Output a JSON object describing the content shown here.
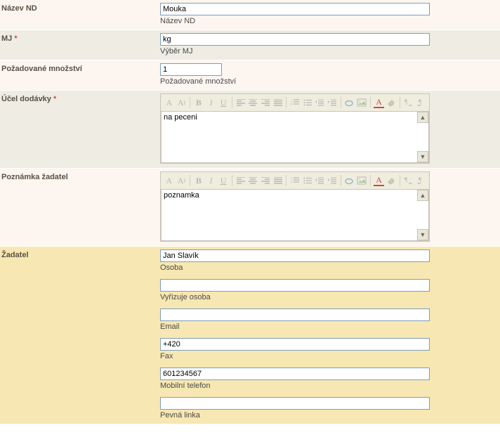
{
  "nazev": {
    "label": "Název ND",
    "value": "Mouka",
    "helper": "Název ND"
  },
  "mj": {
    "label": "MJ",
    "required": "*",
    "value": "kg",
    "helper": "Výběr MJ"
  },
  "mnozstvi": {
    "label": "Požadované množství",
    "value": "1",
    "helper": "Požadované množství"
  },
  "ucel": {
    "label": "Účel dodávky",
    "required": "*",
    "value": "na peceni"
  },
  "poznamka": {
    "label": "Poznámka žadatel",
    "value": "poznamka"
  },
  "zadatel": {
    "label": "Žadatel",
    "osoba_value": "Jan Slavík",
    "osoba_helper": "Osoba",
    "vyrizuje_value": "",
    "vyrizuje_helper": "Vyřizuje osoba",
    "email_value": "",
    "email_helper": "Email",
    "fax_value": "+420",
    "fax_helper": "Fax",
    "mobil_value": "601234567",
    "mobil_helper": "Mobilní telefon",
    "pevna_value": "",
    "pevna_helper": "Pevná linka"
  },
  "rte": {
    "font_family_A": "A",
    "font_size_A": "A",
    "size_indicator": "I",
    "bold": "B",
    "italic": "I",
    "underline": "U",
    "align_left": "al",
    "align_center": "ac",
    "align_right": "ar",
    "align_justify": "aj",
    "list_ol": "ol",
    "list_ul": "ul",
    "outdent": "od",
    "indent": "in",
    "link": "lk",
    "image": "im",
    "color": "A",
    "bgcolor": "bg",
    "ltr": "ltr",
    "rtl": "rtl"
  }
}
